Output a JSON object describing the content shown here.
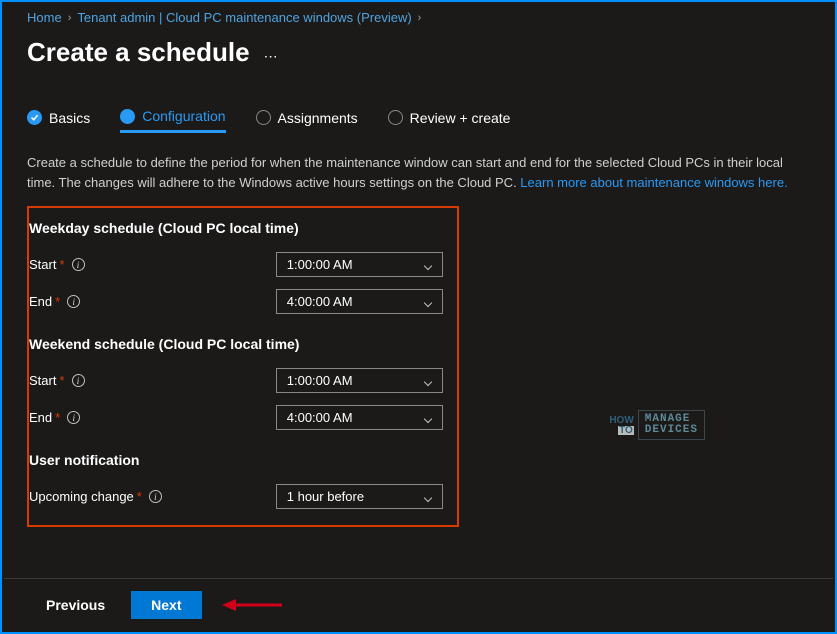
{
  "breadcrumb": {
    "home": "Home",
    "second": "Tenant admin | Cloud PC maintenance windows (Preview)"
  },
  "page": {
    "title": "Create a schedule"
  },
  "tabs": {
    "basics": "Basics",
    "configuration": "Configuration",
    "assignments": "Assignments",
    "review": "Review + create"
  },
  "description": {
    "text1": "Create a schedule to define the period for when the maintenance window can start and end for the selected Cloud PCs in their local time. The changes will adhere to the Windows active hours settings on the Cloud PC. ",
    "link": "Learn more about maintenance windows here."
  },
  "sections": {
    "weekday": {
      "heading": "Weekday schedule (Cloud PC local time)",
      "start_label": "Start",
      "start_value": "1:00:00 AM",
      "end_label": "End",
      "end_value": "4:00:00 AM"
    },
    "weekend": {
      "heading": "Weekend schedule (Cloud PC local time)",
      "start_label": "Start",
      "start_value": "1:00:00 AM",
      "end_label": "End",
      "end_value": "4:00:00 AM"
    },
    "notification": {
      "heading": "User notification",
      "upcoming_label": "Upcoming change",
      "upcoming_value": "1 hour before"
    }
  },
  "footer": {
    "previous": "Previous",
    "next": "Next"
  },
  "watermark": {
    "how": "HOW",
    "to": "TO",
    "line1": "MANAGE",
    "line2": "DEVICES"
  }
}
